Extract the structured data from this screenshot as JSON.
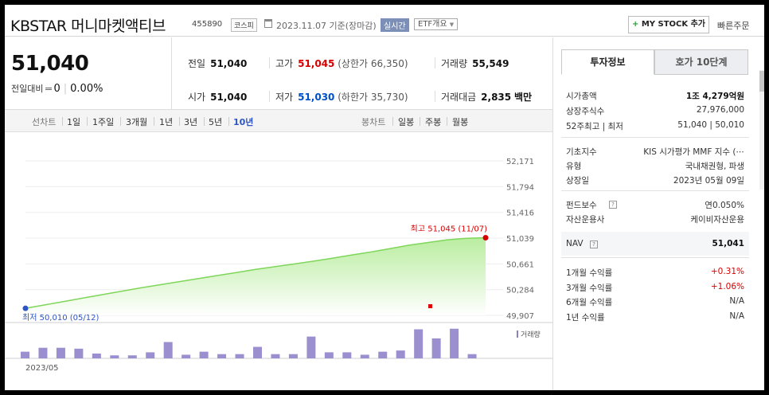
{
  "header": {
    "title": "KBSTAR 머니마켓액티브",
    "code": "455890",
    "market": "코스피",
    "date_text": "2023.11.07 기준(장마감)",
    "realtime": "실시간",
    "etf_info": "ETF개요",
    "mystock": "MY STOCK 추가",
    "quick_order": "빠른주문"
  },
  "price": {
    "current": "51,040",
    "change_label": "전일대비",
    "change_value": "0",
    "change_rate": "0.00%"
  },
  "stats": {
    "prev_close": {
      "label": "전일",
      "value": "51,040"
    },
    "high": {
      "label": "고가",
      "value": "51,045",
      "sub": "(상한가 66,350)"
    },
    "volume": {
      "label": "거래량",
      "value": "55,549"
    },
    "open": {
      "label": "시가",
      "value": "51,040"
    },
    "low": {
      "label": "저가",
      "value": "51,030",
      "sub": "(하한가 35,730)"
    },
    "amount": {
      "label": "거래대금",
      "value": "2,835",
      "unit": "백만"
    }
  },
  "chart_tabs": {
    "line_label": "선차트",
    "periods": [
      "1일",
      "1주일",
      "3개월",
      "1년",
      "3년",
      "5년",
      "10년"
    ],
    "active_period": "10년",
    "candle_label": "봉차트",
    "candles": [
      "일봉",
      "주봉",
      "월봉"
    ]
  },
  "chart_data": {
    "type": "area",
    "y_ticks": [
      "52,171",
      "51,794",
      "51,416",
      "51,039",
      "50,661",
      "50,284",
      "49,907"
    ],
    "ylim": [
      49907,
      52171
    ],
    "x_label": "2023/05",
    "high_annotation": "최고 51,045 (11/07)",
    "low_annotation": "최저 50,010 (05/12)",
    "high_value": 51045,
    "low_value": 50010,
    "series_values": [
      50010,
      50060,
      50110,
      50160,
      50210,
      50260,
      50310,
      50355,
      50400,
      50445,
      50490,
      50535,
      50580,
      50620,
      50660,
      50700,
      50745,
      50790,
      50835,
      50885,
      50935,
      50975,
      51015,
      51035,
      51045
    ],
    "volume_label": "거래량",
    "volume_bars": [
      0.22,
      0.35,
      0.35,
      0.32,
      0.16,
      0.1,
      0.1,
      0.2,
      0.54,
      0.12,
      0.22,
      0.14,
      0.14,
      0.38,
      0.14,
      0.14,
      0.72,
      0.2,
      0.2,
      0.12,
      0.22,
      0.26,
      0.96,
      0.66,
      0.98,
      0.14
    ]
  },
  "info": {
    "tabs": [
      "투자정보",
      "호가 10단계"
    ],
    "rows1": [
      {
        "k": "시가총액",
        "v": "1조 4,279억원",
        "bold": true
      },
      {
        "k": "상장주식수",
        "v": "27,976,000"
      },
      {
        "k": "52주최고 | 최저",
        "v": "51,040 | 50,010"
      }
    ],
    "rows2": [
      {
        "k": "기초지수",
        "v": "KIS 시가평가 MMF 지수 (⋯"
      },
      {
        "k": "유형",
        "v": "국내채권형, 파생"
      },
      {
        "k": "상장일",
        "v": "2023년 05월 09일"
      }
    ],
    "rows3": [
      {
        "k": "펀드보수",
        "v": "연0.050%",
        "q": true
      },
      {
        "k": "자산운용사",
        "v": "케이비자산운용"
      }
    ],
    "nav": {
      "k": "NAV",
      "v": "51,041"
    },
    "rows4": [
      {
        "k": "1개월 수익률",
        "v": "+0.31%",
        "red": true
      },
      {
        "k": "3개월 수익률",
        "v": "+1.06%",
        "red": true
      },
      {
        "k": "6개월 수익률",
        "v": "N/A"
      },
      {
        "k": "1년 수익률",
        "v": "N/A"
      }
    ]
  }
}
